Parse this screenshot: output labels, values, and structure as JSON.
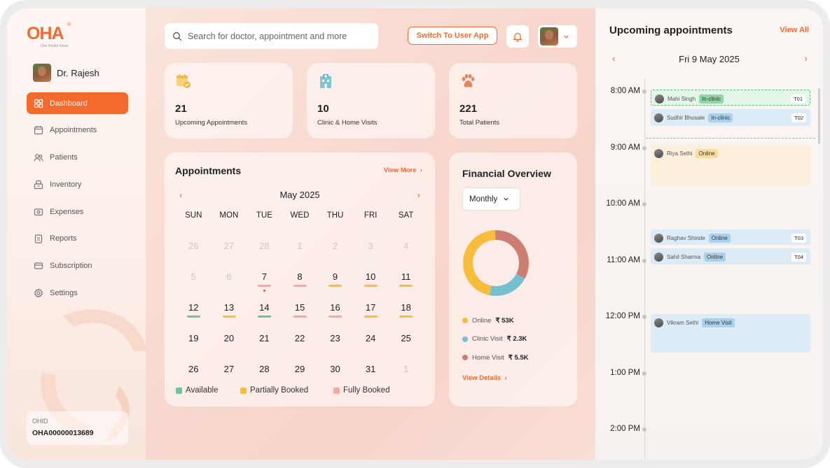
{
  "brand": {
    "logo_text": "OHA",
    "logo_sub": "One Health Assist",
    "reg": "®"
  },
  "colors": {
    "accent": "#f26a2e",
    "available": "#6cc59a",
    "partial": "#f8bd3c",
    "full": "#f4a7a4",
    "online": "#f8bd3c",
    "clinic": "#76bfd1",
    "home": "#cd7e72"
  },
  "profile": {
    "name": "Dr. Rajesh"
  },
  "nav": [
    {
      "label": "Dashboard",
      "icon": "grid-icon"
    },
    {
      "label": "Appointments",
      "icon": "calendar-icon"
    },
    {
      "label": "Patients",
      "icon": "users-icon"
    },
    {
      "label": "Inventory",
      "icon": "box-icon"
    },
    {
      "label": "Expenses",
      "icon": "wallet-icon"
    },
    {
      "label": "Reports",
      "icon": "clipboard-icon"
    },
    {
      "label": "Subscription",
      "icon": "card-icon"
    },
    {
      "label": "Settings",
      "icon": "gear-icon"
    }
  ],
  "ohid": {
    "label": "OHID",
    "value": "OHA00000013689"
  },
  "header": {
    "search_placeholder": "Search for doctor, appointment and more",
    "switch_label": "Switch To User App"
  },
  "stats": [
    {
      "value": "21",
      "label": "Upcoming Appointments",
      "icon": "calendar-check-icon"
    },
    {
      "value": "10",
      "label": "Clinic & Home Visits",
      "icon": "hospital-icon"
    },
    {
      "value": "221",
      "label": "Total Patients",
      "icon": "paw-icon"
    }
  ],
  "appointments_card": {
    "title": "Appointments",
    "view_more": "View More",
    "month": "May 2025",
    "weekdays": [
      "SUN",
      "MON",
      "TUE",
      "WED",
      "THU",
      "FRI",
      "SAT"
    ],
    "weeks": [
      [
        {
          "d": "26",
          "m": true
        },
        {
          "d": "27",
          "m": true
        },
        {
          "d": "28",
          "m": true
        },
        {
          "d": "1",
          "m": true
        },
        {
          "d": "2",
          "m": true
        },
        {
          "d": "3",
          "m": true
        },
        {
          "d": "4",
          "m": true
        }
      ],
      [
        {
          "d": "5",
          "m": true
        },
        {
          "d": "6",
          "m": true
        },
        {
          "d": "7",
          "s": "full",
          "dot": true
        },
        {
          "d": "8",
          "s": "full"
        },
        {
          "d": "9",
          "s": "partial"
        },
        {
          "d": "10",
          "s": "partial"
        },
        {
          "d": "11",
          "s": "partial"
        }
      ],
      [
        {
          "d": "12",
          "s": "available"
        },
        {
          "d": "13",
          "s": "partial"
        },
        {
          "d": "14",
          "s": "available"
        },
        {
          "d": "15",
          "s": "full"
        },
        {
          "d": "16",
          "s": "full"
        },
        {
          "d": "17",
          "s": "partial"
        },
        {
          "d": "18",
          "s": "partial"
        }
      ],
      [
        {
          "d": "19"
        },
        {
          "d": "20"
        },
        {
          "d": "21"
        },
        {
          "d": "22"
        },
        {
          "d": "23"
        },
        {
          "d": "24"
        },
        {
          "d": "25"
        }
      ],
      [
        {
          "d": "26"
        },
        {
          "d": "27"
        },
        {
          "d": "28"
        },
        {
          "d": "29"
        },
        {
          "d": "30"
        },
        {
          "d": "31"
        },
        {
          "d": "1",
          "m": true
        }
      ]
    ],
    "legend": [
      "Available",
      "Partially Booked",
      "Fully Booked"
    ]
  },
  "financial": {
    "title": "Financial Overview",
    "period": "Monthly",
    "items": [
      {
        "label": "Online",
        "amount": "₹ 53K",
        "value": 53
      },
      {
        "label": "Clinic Visit",
        "amount": "₹ 2.3K",
        "value": 23
      },
      {
        "label": "Home Visit",
        "amount": "₹ 5.5K",
        "value": 38
      }
    ],
    "view_details": "View Details"
  },
  "upcoming": {
    "title": "Upcoming appointments",
    "view_all": "View All",
    "date": "Fri 9 May 2025",
    "times": [
      "8:00 AM",
      "9:00 AM",
      "10:00 AM",
      "11:00 AM",
      "12:00 PM",
      "1:00 PM",
      "2:00 PM"
    ],
    "appointments": [
      {
        "name": "Mahi Singh",
        "type": "In-clinic",
        "token": "T01"
      },
      {
        "name": "Sudhir Bhosale",
        "type": "In-clinic",
        "token": "T02"
      },
      {
        "name": "Riya Sethi",
        "type": "Online",
        "token": ""
      },
      {
        "name": "Raghav Shinde",
        "type": "Online",
        "token": "T03"
      },
      {
        "name": "Sahil Sharma",
        "type": "Online",
        "token": "T04"
      },
      {
        "name": "Vikram Sethi",
        "type": "Home Visit",
        "token": ""
      }
    ]
  }
}
